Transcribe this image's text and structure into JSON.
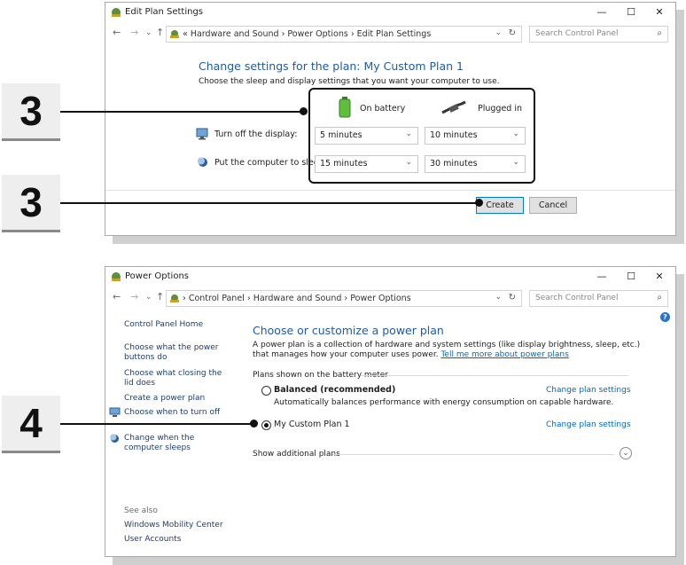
{
  "callouts": {
    "top": "3",
    "middle": "3",
    "bottom": "4"
  },
  "edit_window": {
    "title": "Edit Plan Settings",
    "nav": {
      "back": "←",
      "forward": "→",
      "recent": "⌄",
      "up": "↑"
    },
    "breadcrumb": [
      "«",
      "Hardware and Sound",
      "Power Options",
      "Edit Plan Settings"
    ],
    "search_placeholder": "Search Control Panel",
    "heading": "Change settings for the plan: My Custom Plan 1",
    "subheading": "Choose the sleep and display settings that you want your computer to use.",
    "col_battery": "On battery",
    "col_plugged": "Plugged in",
    "rows": [
      {
        "label": "Turn off the display:",
        "battery": "5 minutes",
        "plugged": "10 minutes",
        "icon": "monitor-icon"
      },
      {
        "label": "Put the computer to sleep:",
        "battery": "15 minutes",
        "plugged": "30 minutes",
        "icon": "moon-icon"
      }
    ],
    "create_label": "Create",
    "cancel_label": "Cancel"
  },
  "power_window": {
    "title": "Power Options",
    "breadcrumb": [
      "Control Panel",
      "Hardware and Sound",
      "Power Options"
    ],
    "search_placeholder": "Search Control Panel",
    "sidebar": {
      "home": "Control Panel Home",
      "items": [
        "Choose what the power buttons do",
        "Choose what closing the lid does",
        "Create a power plan",
        "Choose when to turn off the display",
        "Change when the computer sleeps"
      ],
      "see_also": "See also",
      "links": [
        "Windows Mobility Center",
        "User Accounts"
      ]
    },
    "heading": "Choose or customize a power plan",
    "description": "A power plan is a collection of hardware and system settings (like display brightness, sleep, etc.) that manages how your computer uses power.",
    "learn_more": "Tell me more about power plans",
    "group_label": "Plans shown on the battery meter",
    "plans": [
      {
        "name": "Balanced (recommended)",
        "description": "Automatically balances performance with energy consumption on capable hardware.",
        "selected": false,
        "link": "Change plan settings"
      },
      {
        "name": "My Custom Plan 1",
        "description": "",
        "selected": true,
        "link": "Change plan settings"
      }
    ],
    "show_additional": "Show additional plans",
    "help": "?"
  },
  "window_controls": {
    "minimize": "—",
    "maximize": "☐",
    "close": "✕"
  },
  "colors": {
    "heading_blue": "#1f5ba6",
    "link_blue": "#0066cc",
    "accent": "#0078d7"
  }
}
